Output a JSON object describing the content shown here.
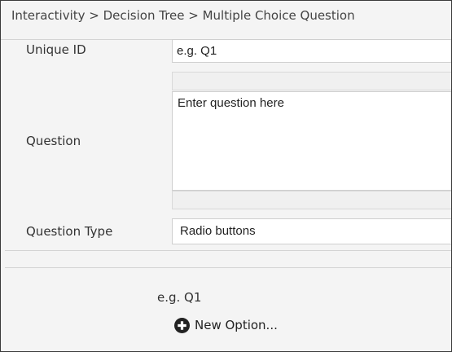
{
  "breadcrumb": {
    "items": [
      "Interactivity",
      "Decision Tree",
      "Multiple Choice Question"
    ],
    "text": "Interactivity > Decision Tree > Multiple Choice Question"
  },
  "form": {
    "unique_id": {
      "label": "Unique ID",
      "value": "e.g. Q1"
    },
    "question": {
      "label": "Question",
      "value": "Enter question here"
    },
    "question_type": {
      "label": "Question Type",
      "value": "Radio buttons"
    }
  },
  "options": {
    "first_option_text": "e.g. Q1",
    "new_option_label": "New Option...",
    "new_option_icon": "plus-circle-icon"
  },
  "colors": {
    "background": "#f4f4f4",
    "field_background": "#ffffff",
    "border": "#cfcfcf",
    "icon": "#222222"
  }
}
